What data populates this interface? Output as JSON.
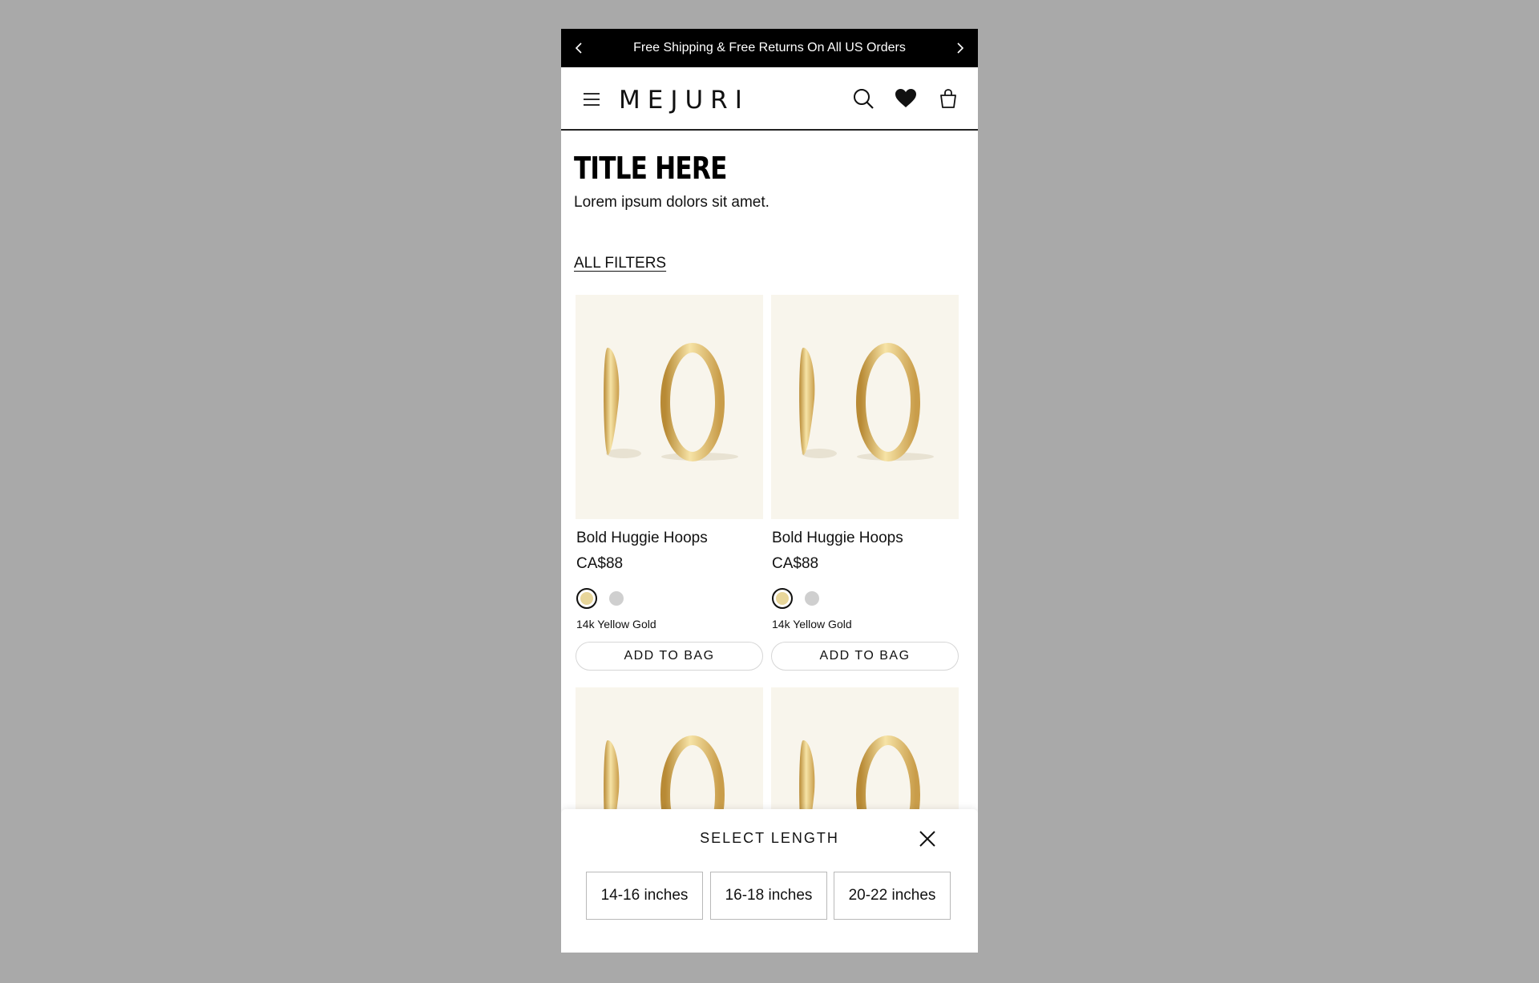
{
  "announcement": {
    "text": "Free Shipping & Free Returns On All US Orders",
    "prev_icon": "chevron-left-icon",
    "next_icon": "chevron-right-icon"
  },
  "header": {
    "logo": "MEJURI",
    "icons": [
      "menu-icon",
      "search-icon",
      "heart-icon",
      "bag-icon"
    ]
  },
  "page": {
    "title": "TITLE HERE",
    "subtitle": "Lorem ipsum dolors sit amet.",
    "filters_label": "ALL FILTERS"
  },
  "products": [
    {
      "name": "Bold Huggie Hoops",
      "price": "CA$88",
      "metal": "14k Yellow Gold",
      "cta": "ADD TO BAG"
    },
    {
      "name": "Bold Huggie Hoops",
      "price": "CA$88",
      "metal": "14k Yellow Gold",
      "cta": "ADD TO BAG"
    },
    {
      "name": "",
      "price": "",
      "metal": "",
      "cta": ""
    },
    {
      "name": "",
      "price": "",
      "metal": "",
      "cta": ""
    }
  ],
  "sheet": {
    "title": "SELECT LENGTH",
    "options": [
      "14-16 inches",
      "16-18 inches",
      "20-22 inches"
    ]
  },
  "colors": {
    "background": "#a9a9a9",
    "image_bg": "#f8f5ec",
    "gold_swatch": "#e8d69a",
    "silver_swatch": "#cfcfcf"
  }
}
